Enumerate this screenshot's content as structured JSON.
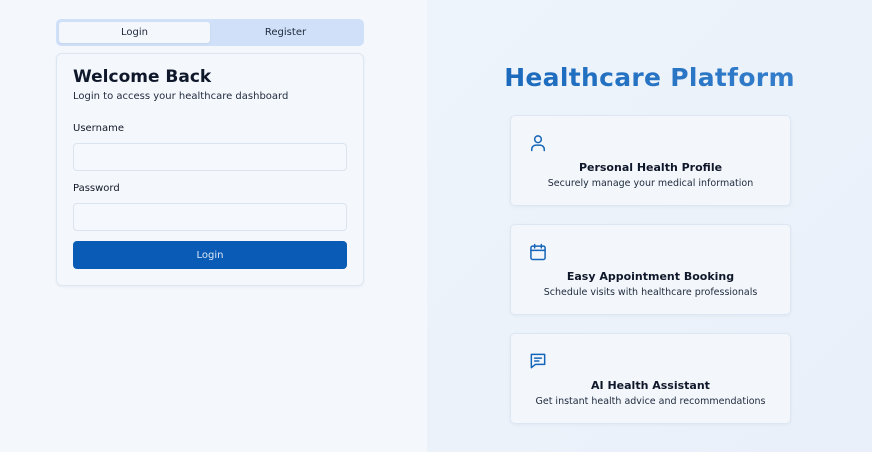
{
  "tabs": [
    {
      "label": "Login",
      "active": true
    },
    {
      "label": "Register",
      "active": false
    }
  ],
  "login_card": {
    "title": "Welcome Back",
    "subtitle": "Login to access your healthcare dashboard",
    "username_label": "Username",
    "username_value": "",
    "password_label": "Password",
    "password_value": "",
    "submit_label": "Login"
  },
  "platform": {
    "title": "Healthcare Platform",
    "features": [
      {
        "icon": "user-icon",
        "title": "Personal Health Profile",
        "description": "Securely manage your medical information"
      },
      {
        "icon": "calendar-icon",
        "title": "Easy Appointment Booking",
        "description": "Schedule visits with healthcare professionals"
      },
      {
        "icon": "chat-icon",
        "title": "AI Health Assistant",
        "description": "Get instant health advice and recommendations"
      }
    ]
  },
  "colors": {
    "primary": "#0a5bb5",
    "accent": "#1565b8",
    "tab_track": "#cfe0f8"
  }
}
